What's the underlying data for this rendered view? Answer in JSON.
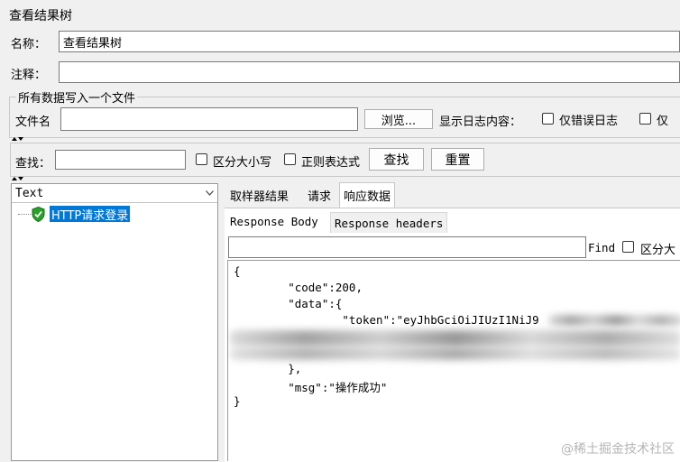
{
  "window_title": "查看结果树",
  "name": {
    "label": "名称：",
    "value": "查看结果树"
  },
  "comment": {
    "label": "注释：",
    "value": ""
  },
  "file_section": {
    "legend": "所有数据写入一个文件",
    "filename_label": "文件名",
    "filename_value": "",
    "browse_label": "浏览...",
    "log_content_label": "显示日志内容：",
    "errors_only_label": "仅错误日志",
    "success_only_label": "仅"
  },
  "search": {
    "label": "查找：",
    "value": "",
    "case_label": "区分大小写",
    "regex_label": "正则表达式",
    "find_label": "查找",
    "reset_label": "重置"
  },
  "left_panel": {
    "renderer": "Text",
    "tree_items": [
      {
        "label": "HTTP请求登录",
        "status": "success"
      }
    ]
  },
  "tabs": [
    {
      "label": "取样器结果"
    },
    {
      "label": "请求"
    },
    {
      "label": "响应数据",
      "active": true
    }
  ],
  "subtabs": [
    {
      "label": "Response Body",
      "active": true
    },
    {
      "label": "Response headers"
    }
  ],
  "response_find": {
    "label": "Find",
    "case_label": "区分大"
  },
  "response_body": {
    "lines": [
      "{",
      "        \"code\":200,",
      "        \"data\":{",
      "                \"token\":\"eyJhbGciOiJIUzI1NiJ9",
      "",
      "",
      "        },",
      "        \"msg\":\"操作成功\"",
      "}"
    ]
  },
  "watermark": "@稀土掘金技术社区"
}
